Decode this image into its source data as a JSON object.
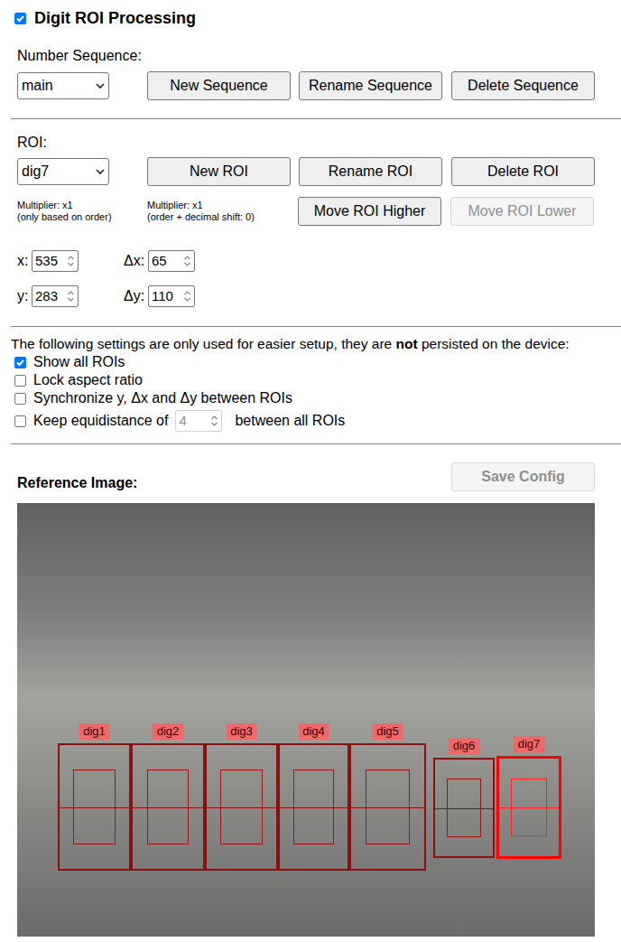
{
  "title": {
    "label": "Digit ROI Processing",
    "checked": true
  },
  "sequence": {
    "label": "Number Sequence:",
    "value": "main",
    "buttons": [
      {
        "label": "New Sequence",
        "disabled": false
      },
      {
        "label": "Rename Sequence",
        "disabled": false
      },
      {
        "label": "Delete Sequence",
        "disabled": false
      }
    ]
  },
  "roi": {
    "label": "ROI:",
    "value": "dig7",
    "buttons": [
      {
        "label": "New ROI",
        "disabled": false
      },
      {
        "label": "Rename ROI",
        "disabled": false
      },
      {
        "label": "Delete ROI",
        "disabled": false
      }
    ],
    "multipliers": [
      {
        "line1": "Multiplier: x1",
        "line2": "(only based on order)"
      },
      {
        "line1": "Multiplier: x1",
        "line2": "(order + decimal shift: 0)"
      }
    ],
    "move_buttons": [
      {
        "label": "Move ROI Higher",
        "disabled": false
      },
      {
        "label": "Move ROI Lower",
        "disabled": true
      }
    ],
    "fields": [
      {
        "label": "x:",
        "value": "535"
      },
      {
        "label": "Δx:",
        "value": "65"
      },
      {
        "label": "y:",
        "value": "283"
      },
      {
        "label": "Δy:",
        "value": "110"
      }
    ]
  },
  "setup": {
    "note_before": "The following settings are only used for easier setup, they are ",
    "note_bold": "not",
    "note_after": " persisted on the device:",
    "options": [
      {
        "kind": "checkbox",
        "label": "Show all ROIs",
        "checked": true
      },
      {
        "kind": "checkbox",
        "label": "Lock aspect ratio",
        "checked": false
      },
      {
        "kind": "checkbox",
        "label": "Synchronize y, Δx and Δy between ROIs",
        "checked": false
      },
      {
        "kind": "equidistance",
        "label": "Keep equidistance of",
        "value": "4",
        "label_after": "between all ROIs",
        "checked": false,
        "disabled": true
      }
    ]
  },
  "reference": {
    "label": "Reference Image:",
    "save_button": {
      "label": "Save Config",
      "disabled": true
    },
    "rois": [
      {
        "label": "dig1",
        "selected": false
      },
      {
        "label": "dig2",
        "selected": false
      },
      {
        "label": "dig3",
        "selected": false
      },
      {
        "label": "dig4",
        "selected": false
      },
      {
        "label": "dig5",
        "selected": false
      },
      {
        "label": "dig6",
        "selected": false
      },
      {
        "label": "dig7",
        "selected": true
      }
    ]
  }
}
